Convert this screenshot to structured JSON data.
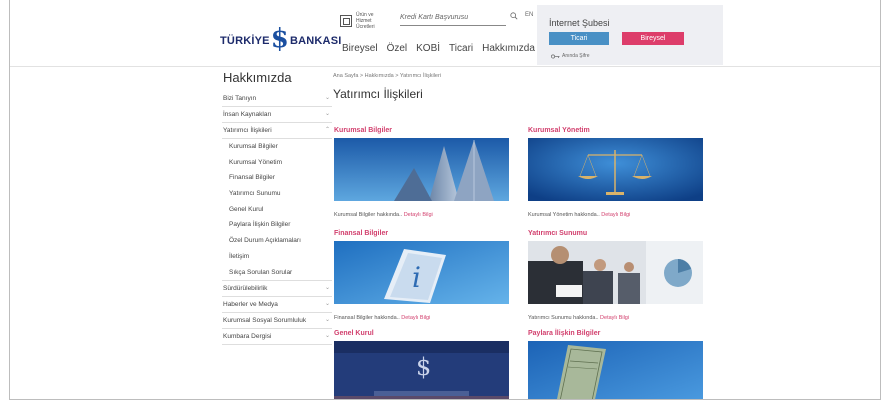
{
  "header": {
    "logo_left": "TÜRKİYE",
    "logo_symbol": "$",
    "logo_right": "BANKASI",
    "products_label": "Ürün ve Hizmet Ücretleri",
    "search_placeholder": "Kredi Kartı Başvurusu",
    "lang": "EN",
    "nav": [
      "Bireysel",
      "Özel",
      "KOBİ",
      "Ticari",
      "Hakkımızda"
    ]
  },
  "internet_banking": {
    "title": "İnternet Şubesi",
    "ticari": "Ticari",
    "bireysel": "Bireysel",
    "secure": "Anında Şifre"
  },
  "sidebar": {
    "title": "Hakkımızda",
    "items_top": [
      {
        "label": "Bizi Tanıyın",
        "chev": "⌄"
      },
      {
        "label": "İnsan Kaynakları",
        "chev": "⌄"
      },
      {
        "label": "Yatırımcı İlişkileri",
        "chev": "⌃"
      }
    ],
    "sub_items": [
      "Kurumsal Bilgiler",
      "Kurumsal Yönetim",
      "Finansal Bilgiler",
      "Yatırımcı Sunumu",
      "Genel Kurul",
      "Paylara İlişkin Bilgiler",
      "Özel Durum Açıklamaları",
      "İletişim",
      "Sıkça Sorulan Sorular"
    ],
    "items_bottom": [
      {
        "label": "Sürdürülebilirlik",
        "chev": "⌄"
      },
      {
        "label": "Haberler ve Medya",
        "chev": "⌄"
      },
      {
        "label": "Kurumsal Sosyal Sorumluluk",
        "chev": "⌄"
      },
      {
        "label": "Kumbara Dergisi",
        "chev": "⌄"
      }
    ]
  },
  "main": {
    "breadcrumb": "Ana Sayfa > Hakkımızda > Yatırımcı İlişkileri",
    "title": "Yatırımcı İlişkileri",
    "more_label": "Detaylı Bilgi",
    "cards": [
      {
        "title": "Kurumsal Bilgiler",
        "desc": "Kurumsal Bilgiler hakkında.."
      },
      {
        "title": "Kurumsal Yönetim",
        "desc": "Kurumsal Yönetim hakkında.."
      },
      {
        "title": "Finansal Bilgiler",
        "desc": "Finansal Bilgiler hakkında.."
      },
      {
        "title": "Yatırımcı Sunumu",
        "desc": "Yatırımcı Sunumu hakkında.."
      },
      {
        "title": "Genel Kurul",
        "desc": ""
      },
      {
        "title": "Paylara İlişkin Bilgiler",
        "desc": ""
      }
    ]
  },
  "colors": {
    "accent_pink": "#d2406e",
    "ticari_blue": "#4990c5",
    "bireysel_pink": "#dd3d6a",
    "brand_navy": "#1d2b6b"
  }
}
